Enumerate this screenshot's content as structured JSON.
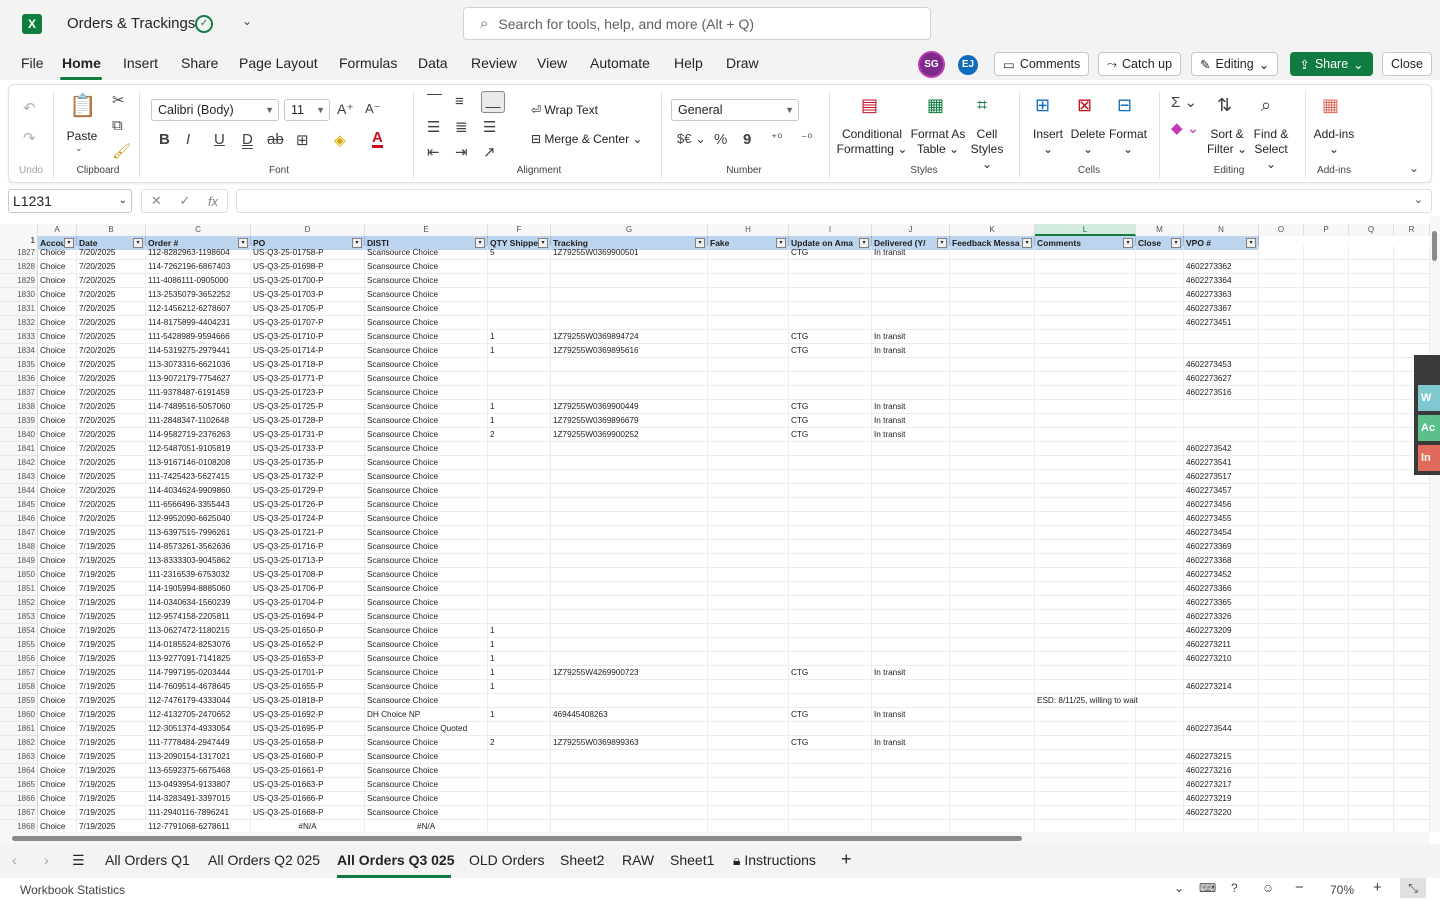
{
  "app": {
    "logo": "X",
    "title": "Orders & Trackings",
    "save_icon": "cloud-check-icon"
  },
  "search": {
    "placeholder": "Search for tools, help, and more (Alt + Q)"
  },
  "menu": [
    "File",
    "Home",
    "Insert",
    "Share",
    "Page Layout",
    "Formulas",
    "Data",
    "Review",
    "View",
    "Automate",
    "Help",
    "Draw"
  ],
  "avatars": [
    {
      "initials": "SG",
      "color": "#7b2c8b"
    },
    {
      "initials": "EJ",
      "color": "#0f6cbd"
    }
  ],
  "actions": {
    "comments": "Comments",
    "catchup": "Catch up",
    "editing": "Editing",
    "share": "Share",
    "close": "Close"
  },
  "ribbon": {
    "undo_label": "Undo",
    "clipboard": {
      "paste": "Paste",
      "label": "Clipboard"
    },
    "font": {
      "family": "Calibri (Body)",
      "size": "11",
      "label": "Font"
    },
    "alignment": {
      "wrap": "Wrap Text",
      "merge": "Merge & Center",
      "label": "Alignment"
    },
    "number": {
      "format": "General",
      "label": "Number"
    },
    "styles": {
      "cond1": "Conditional",
      "cond2": "Formatting",
      "fmt1": "Format As",
      "fmt2": "Table",
      "cell1": "Cell",
      "cell2": "Styles",
      "label": "Styles"
    },
    "cells": {
      "insert": "Insert",
      "delete": "Delete",
      "format": "Format",
      "label": "Cells"
    },
    "editing": {
      "sort1": "Sort &",
      "sort2": "Filter",
      "find1": "Find &",
      "find2": "Select",
      "label": "Editing"
    },
    "addins": {
      "btn": "Add-ins",
      "label": "Add-ins"
    }
  },
  "namebox": "L1231",
  "columns": [
    "A",
    "B",
    "C",
    "D",
    "E",
    "F",
    "G",
    "H",
    "I",
    "J",
    "K",
    "L",
    "M",
    "N",
    "O",
    "P",
    "Q",
    "R"
  ],
  "headers": [
    "Accou",
    "Date",
    "Order #",
    "PO",
    "DISTI",
    "QTY Shippe",
    "Tracking",
    "Fake",
    "Update on Ama",
    "Delivered (Y/",
    "Feedback Messa",
    "Comments",
    "Close",
    "VPO #"
  ],
  "rows": [
    [
      "1827",
      "Choice",
      "7/20/2025",
      "112-8282963-1198604",
      "US-Q3-25-01758-P",
      "Scansource Choice",
      "5",
      "1Z79255W0369900501",
      "",
      "CTG",
      "In transit",
      "",
      "",
      "",
      ""
    ],
    [
      "1828",
      "Choice",
      "7/20/2025",
      "114-7262196-6867403",
      "US-Q3-25-01698-P",
      "Scansource Choice",
      "",
      "",
      "",
      "",
      "",
      "",
      "",
      "",
      "4602273362"
    ],
    [
      "1829",
      "Choice",
      "7/20/2025",
      "111-4086111-0905000",
      "US-Q3-25-01700-P",
      "Scansource Choice",
      "",
      "",
      "",
      "",
      "",
      "",
      "",
      "",
      "4602273364"
    ],
    [
      "1830",
      "Choice",
      "7/20/2025",
      "113-2535079-3652252",
      "US-Q3-25-01703-P",
      "Scansource Choice",
      "",
      "",
      "",
      "",
      "",
      "",
      "",
      "",
      "4602273363"
    ],
    [
      "1831",
      "Choice",
      "7/20/2025",
      "112-1456212-6278607",
      "US-Q3-25-01705-P",
      "Scansource Choice",
      "",
      "",
      "",
      "",
      "",
      "",
      "",
      "",
      "4602273367"
    ],
    [
      "1832",
      "Choice",
      "7/20/2025",
      "114-8175899-4404231",
      "US-Q3-25-01707-P",
      "Scansource Choice",
      "",
      "",
      "",
      "",
      "",
      "",
      "",
      "",
      "4602273451"
    ],
    [
      "1833",
      "Choice",
      "7/20/2025",
      "111-5428989-9594666",
      "US-Q3-25-01710-P",
      "Scansource Choice",
      "1",
      "1Z79255W0369894724",
      "",
      "CTG",
      "In transit",
      "",
      "",
      "",
      ""
    ],
    [
      "1834",
      "Choice",
      "7/20/2025",
      "114-5319275-2979441",
      "US-Q3-25-01714-P",
      "Scansource Choice",
      "1",
      "1Z79255W0369895616",
      "",
      "CTG",
      "In transit",
      "",
      "",
      "",
      ""
    ],
    [
      "1835",
      "Choice",
      "7/20/2025",
      "113-3073316-6621036",
      "US-Q3-25-01718-P",
      "Scansource Choice",
      "",
      "",
      "",
      "",
      "",
      "",
      "",
      "",
      "4602273453"
    ],
    [
      "1836",
      "Choice",
      "7/20/2025",
      "113-9072179-7754627",
      "US-Q3-25-01771-P",
      "Scansource Choice",
      "",
      "",
      "",
      "",
      "",
      "",
      "",
      "",
      "4602273627"
    ],
    [
      "1837",
      "Choice",
      "7/20/2025",
      "111-9378487-6191459",
      "US-Q3-25-01723-P",
      "Scansource Choice",
      "",
      "",
      "",
      "",
      "",
      "",
      "",
      "",
      "4602273516"
    ],
    [
      "1838",
      "Choice",
      "7/20/2025",
      "114-7489516-5057060",
      "US-Q3-25-01725-P",
      "Scansource Choice",
      "1",
      "1Z79255W0369900449",
      "",
      "CTG",
      "In transit",
      "",
      "",
      "",
      ""
    ],
    [
      "1839",
      "Choice",
      "7/20/2025",
      "111-2848347-1102648",
      "US-Q3-25-01728-P",
      "Scansource Choice",
      "1",
      "1Z79255W0369896679",
      "",
      "CTG",
      "In transit",
      "",
      "",
      "",
      ""
    ],
    [
      "1840",
      "Choice",
      "7/20/2025",
      "114-9582719-2376263",
      "US-Q3-25-01731-P",
      "Scansource Choice",
      "2",
      "1Z79255W0369900252",
      "",
      "CTG",
      "In transit",
      "",
      "",
      "",
      ""
    ],
    [
      "1841",
      "Choice",
      "7/20/2025",
      "112-5487051-9105819",
      "US-Q3-25-01733-P",
      "Scansource Choice",
      "",
      "",
      "",
      "",
      "",
      "",
      "",
      "",
      "4602273542"
    ],
    [
      "1842",
      "Choice",
      "7/20/2025",
      "113-9167146-0108208",
      "US-Q3-25-01735-P",
      "Scansource Choice",
      "",
      "",
      "",
      "",
      "",
      "",
      "",
      "",
      "4602273541"
    ],
    [
      "1843",
      "Choice",
      "7/20/2025",
      "111-7425423-5627415",
      "US-Q3-25-01732-P",
      "Scansource Choice",
      "",
      "",
      "",
      "",
      "",
      "",
      "",
      "",
      "4602273517"
    ],
    [
      "1844",
      "Choice",
      "7/20/2025",
      "114-4034624-9909860",
      "US-Q3-25-01729-P",
      "Scansource Choice",
      "",
      "",
      "",
      "",
      "",
      "",
      "",
      "",
      "4602273457"
    ],
    [
      "1845",
      "Choice",
      "7/20/2025",
      "111-6566496-3355443",
      "US-Q3-25-01726-P",
      "Scansource Choice",
      "",
      "",
      "",
      "",
      "",
      "",
      "",
      "",
      "4602273456"
    ],
    [
      "1846",
      "Choice",
      "7/20/2025",
      "112-9952090-6625040",
      "US-Q3-25-01724-P",
      "Scansource Choice",
      "",
      "",
      "",
      "",
      "",
      "",
      "",
      "",
      "4602273455"
    ],
    [
      "1847",
      "Choice",
      "7/19/2025",
      "113-6397515-7996261",
      "US-Q3-25-01721-P",
      "Scansource Choice",
      "",
      "",
      "",
      "",
      "",
      "",
      "",
      "",
      "4602273454"
    ],
    [
      "1848",
      "Choice",
      "7/19/2025",
      "114-8573261-3562636",
      "US-Q3-25-01716-P",
      "Scansource Choice",
      "",
      "",
      "",
      "",
      "",
      "",
      "",
      "",
      "4602273369"
    ],
    [
      "1849",
      "Choice",
      "7/19/2025",
      "113-8333303-9045862",
      "US-Q3-25-01713-P",
      "Scansource Choice",
      "",
      "",
      "",
      "",
      "",
      "",
      "",
      "",
      "4602273368"
    ],
    [
      "1850",
      "Choice",
      "7/19/2025",
      "111-2316539-6753032",
      "US-Q3-25-01708-P",
      "Scansource Choice",
      "",
      "",
      "",
      "",
      "",
      "",
      "",
      "",
      "4602273452"
    ],
    [
      "1851",
      "Choice",
      "7/19/2025",
      "114-1905994-8885060",
      "US-Q3-25-01706-P",
      "Scansource Choice",
      "",
      "",
      "",
      "",
      "",
      "",
      "",
      "",
      "4602273366"
    ],
    [
      "1852",
      "Choice",
      "7/19/2025",
      "114-0340634-1560239",
      "US-Q3-25-01704-P",
      "Scansource Choice",
      "",
      "",
      "",
      "",
      "",
      "",
      "",
      "",
      "4602273365"
    ],
    [
      "1853",
      "Choice",
      "7/19/2025",
      "112-9574158-2205811",
      "US-Q3-25-01694-P",
      "Scansource Choice",
      "",
      "",
      "",
      "",
      "",
      "",
      "",
      "",
      "4602273326"
    ],
    [
      "1854",
      "Choice",
      "7/19/2025",
      "113-0627472-1180215",
      "US-Q3-25-01650-P",
      "Scansource Choice",
      "1",
      "",
      "",
      "",
      "",
      "",
      "",
      "",
      "4602273209"
    ],
    [
      "1855",
      "Choice",
      "7/19/2025",
      "114-0185524-8253076",
      "US-Q3-25-01652-P",
      "Scansource Choice",
      "1",
      "",
      "",
      "",
      "",
      "",
      "",
      "",
      "4602273211"
    ],
    [
      "1856",
      "Choice",
      "7/19/2025",
      "113-9277091-7141825",
      "US-Q3-25-01653-P",
      "Scansource Choice",
      "1",
      "",
      "",
      "",
      "",
      "",
      "",
      "",
      "4602273210"
    ],
    [
      "1857",
      "Choice",
      "7/19/2025",
      "114-7997195-0203444",
      "US-Q3-25-01701-P",
      "Scansource Choice",
      "1",
      "1Z79255W4269900723",
      "",
      "CTG",
      "In transit",
      "",
      "",
      "",
      ""
    ],
    [
      "1858",
      "Choice",
      "7/19/2025",
      "114-7609514-4678645",
      "US-Q3-25-01655-P",
      "Scansource Choice",
      "1",
      "",
      "",
      "",
      "",
      "",
      "",
      "",
      "4602273214"
    ],
    [
      "1859",
      "Choice",
      "7/19/2025",
      "112-7476179-4333044",
      "US-Q3-25-01818-P",
      "Scansource Choice",
      "",
      "",
      "",
      "",
      "",
      "",
      "ESD: 8/11/25, willing to wait",
      "",
      ""
    ],
    [
      "1860",
      "Choice",
      "7/19/2025",
      "112-4132705-2470652",
      "US-Q3-25-01692-P",
      "DH Choice NP",
      "1",
      "469445408263",
      "",
      "CTG",
      "In transit",
      "",
      "",
      "",
      ""
    ],
    [
      "1861",
      "Choice",
      "7/19/2025",
      "112-3051374-4933054",
      "US-Q3-25-01695-P",
      "Scansource Choice Quoted",
      "",
      "",
      "",
      "",
      "",
      "",
      "",
      "",
      "4602273544"
    ],
    [
      "1862",
      "Choice",
      "7/19/2025",
      "111-7778484-2947449",
      "US-Q3-25-01658-P",
      "Scansource Choice",
      "2",
      "1Z79255W0369899363",
      "",
      "CTG",
      "In transit",
      "",
      "",
      "",
      ""
    ],
    [
      "1863",
      "Choice",
      "7/19/2025",
      "113-2090154-1317021",
      "US-Q3-25-01660-P",
      "Scansource Choice",
      "",
      "",
      "",
      "",
      "",
      "",
      "",
      "",
      "4602273215"
    ],
    [
      "1864",
      "Choice",
      "7/19/2025",
      "113-6592375-6675468",
      "US-Q3-25-01661-P",
      "Scansource Choice",
      "",
      "",
      "",
      "",
      "",
      "",
      "",
      "",
      "4602273216"
    ],
    [
      "1865",
      "Choice",
      "7/19/2025",
      "113-0493954-9133807",
      "US-Q3-25-01663-P",
      "Scansource Choice",
      "",
      "",
      "",
      "",
      "",
      "",
      "",
      "",
      "4602273217"
    ],
    [
      "1866",
      "Choice",
      "7/19/2025",
      "114-3283491-3397015",
      "US-Q3-25-01666-P",
      "Scansource Choice",
      "",
      "",
      "",
      "",
      "",
      "",
      "",
      "",
      "4602273219"
    ],
    [
      "1867",
      "Choice",
      "7/19/2025",
      "111-2940116-7896241",
      "US-Q3-25-01668-P",
      "Scansource Choice",
      "",
      "",
      "",
      "",
      "",
      "",
      "",
      "",
      "4602273220"
    ],
    [
      "1868",
      "Choice",
      "7/19/2025",
      "112-7791068-6278611",
      "#N/A",
      "#N/A",
      "",
      "",
      "",
      "",
      "",
      "",
      "",
      "",
      ""
    ]
  ],
  "side_panel": [
    {
      "text": "W",
      "color": "#7fc8d0"
    },
    {
      "text": "Ac",
      "color": "#5cc08a"
    },
    {
      "text": "In",
      "color": "#e06b5c"
    }
  ],
  "tabs": [
    "All Orders Q1",
    "All Orders Q2 025",
    "All Orders Q3 025",
    "OLD Orders",
    "Sheet2",
    "RAW",
    "Sheet1",
    "Instructions"
  ],
  "active_tab": "All Orders Q3 025",
  "status": {
    "left": "Workbook Statistics",
    "zoom": "70%"
  }
}
